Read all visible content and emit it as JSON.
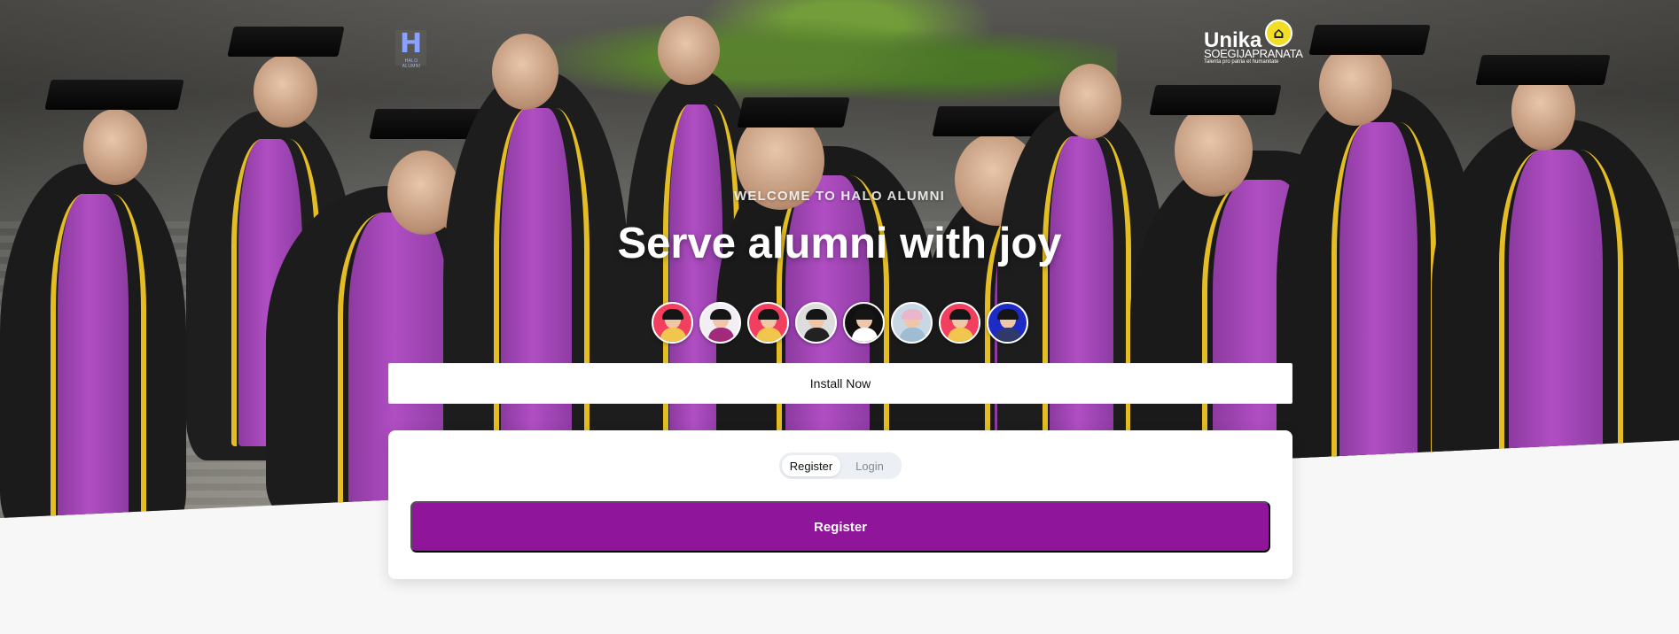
{
  "brand": {
    "left_logo_mark": "H",
    "left_logo_text": "HALO ALUMNI",
    "right_logo_wordmark": "Unika",
    "right_logo_subtitle": "SOEGIJAPRANATA",
    "right_logo_motto": "Talenta pro patria et humanitate"
  },
  "hero": {
    "eyebrow": "WELCOME TO HALO ALUMNI",
    "title": "Serve alumni with joy"
  },
  "install": {
    "label": "Install Now"
  },
  "auth": {
    "tabs": [
      {
        "label": "Register",
        "selected": true
      },
      {
        "label": "Login",
        "selected": false
      }
    ],
    "primary_button": "Register"
  },
  "colors": {
    "primary": "#8f169b",
    "card": "#ffffff",
    "page_background": "#f7f7f7"
  },
  "icons": {
    "left_logo": "halo-alumni-logo-icon",
    "right_logo": "unika-soegijapranata-logo-icon",
    "avatars": [
      "avatar-red-icon",
      "avatar-pink-icon",
      "avatar-red-icon",
      "avatar-photo-icon",
      "avatar-black-icon",
      "avatar-light-icon",
      "avatar-red-icon",
      "avatar-blue-icon"
    ]
  }
}
